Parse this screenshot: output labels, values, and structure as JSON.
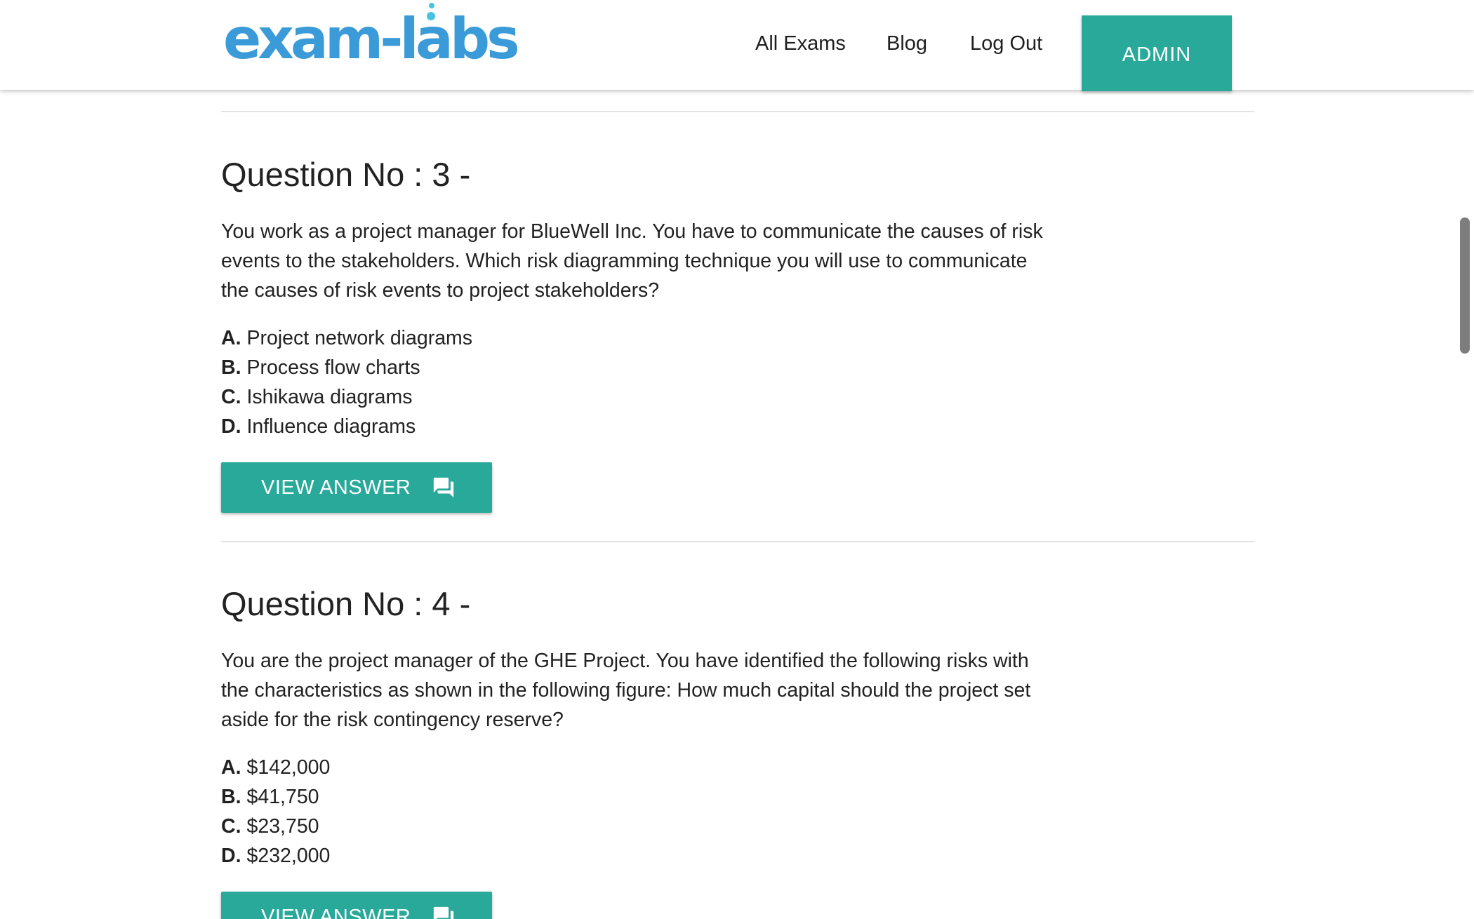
{
  "header": {
    "logo_text": "exam-labs",
    "nav": [
      {
        "label": "All Exams"
      },
      {
        "label": "Blog"
      },
      {
        "label": "Log Out"
      }
    ],
    "admin_label": "ADMIN"
  },
  "colors": {
    "accent": "#28a99a",
    "logo_blue": "#3a9bd8",
    "logo_bubble": "#47c3df",
    "divider": "#e2e2e2"
  },
  "questions": [
    {
      "title": "Question No : 3 -",
      "text": "You work as a project manager for BlueWell Inc. You have to communicate the causes of risk events to the stakeholders. Which risk diagramming technique you will use to communicate the causes of risk events to project stakeholders?",
      "options": [
        {
          "letter": "A.",
          "text": "Project network diagrams"
        },
        {
          "letter": "B.",
          "text": "Process flow charts"
        },
        {
          "letter": "C.",
          "text": "Ishikawa diagrams"
        },
        {
          "letter": "D.",
          "text": "Influence diagrams"
        }
      ],
      "button_label": "VIEW ANSWER",
      "button_icon": "forum-chat-icon"
    },
    {
      "title": "Question No : 4 -",
      "text": "You are the project manager of the GHE Project. You have identified the following risks with the characteristics as shown in the following figure: How much capital should the project set aside for the risk contingency reserve?",
      "options": [
        {
          "letter": "A.",
          "text": "$142,000"
        },
        {
          "letter": "B.",
          "text": "$41,750"
        },
        {
          "letter": "C.",
          "text": "$23,750"
        },
        {
          "letter": "D.",
          "text": "$232,000"
        }
      ],
      "button_label": "VIEW ANSWER",
      "button_icon": "forum-chat-icon"
    }
  ]
}
